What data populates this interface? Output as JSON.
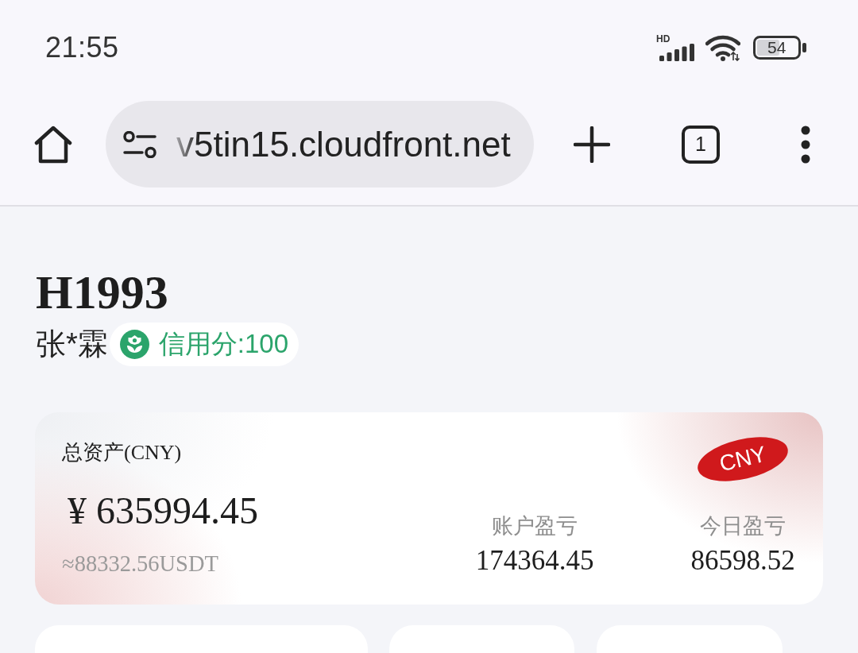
{
  "status_bar": {
    "time": "21:55",
    "network_label": "HD",
    "battery": "54"
  },
  "browser_toolbar": {
    "url": "v5tin15.cloudfront.net",
    "tab_count": "1"
  },
  "profile": {
    "title": "H1993",
    "name": "张*霖",
    "credit_badge": "信用分:100"
  },
  "asset_card": {
    "label": "总资产(CNY)",
    "amount": "¥ 635994.45",
    "usdt_equivalent": "≈88332.56USDT",
    "currency_tag": "CNY",
    "stats": [
      {
        "label": "账户盈亏",
        "value": "174364.45"
      },
      {
        "label": "今日盈亏",
        "value": "86598.52"
      }
    ]
  }
}
